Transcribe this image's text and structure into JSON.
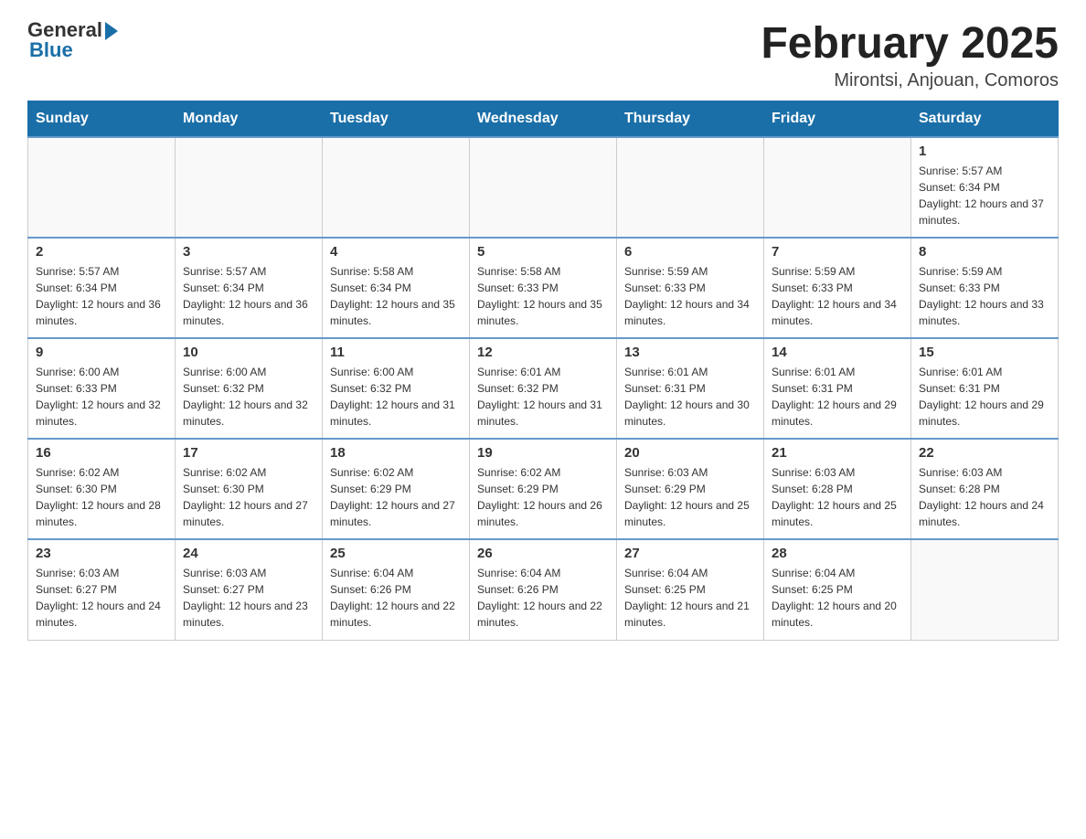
{
  "logo": {
    "general": "General",
    "blue": "Blue"
  },
  "title": "February 2025",
  "subtitle": "Mirontsi, Anjouan, Comoros",
  "days_of_week": [
    "Sunday",
    "Monday",
    "Tuesday",
    "Wednesday",
    "Thursday",
    "Friday",
    "Saturday"
  ],
  "weeks": [
    [
      {
        "day": "",
        "info": ""
      },
      {
        "day": "",
        "info": ""
      },
      {
        "day": "",
        "info": ""
      },
      {
        "day": "",
        "info": ""
      },
      {
        "day": "",
        "info": ""
      },
      {
        "day": "",
        "info": ""
      },
      {
        "day": "1",
        "info": "Sunrise: 5:57 AM\nSunset: 6:34 PM\nDaylight: 12 hours and 37 minutes."
      }
    ],
    [
      {
        "day": "2",
        "info": "Sunrise: 5:57 AM\nSunset: 6:34 PM\nDaylight: 12 hours and 36 minutes."
      },
      {
        "day": "3",
        "info": "Sunrise: 5:57 AM\nSunset: 6:34 PM\nDaylight: 12 hours and 36 minutes."
      },
      {
        "day": "4",
        "info": "Sunrise: 5:58 AM\nSunset: 6:34 PM\nDaylight: 12 hours and 35 minutes."
      },
      {
        "day": "5",
        "info": "Sunrise: 5:58 AM\nSunset: 6:33 PM\nDaylight: 12 hours and 35 minutes."
      },
      {
        "day": "6",
        "info": "Sunrise: 5:59 AM\nSunset: 6:33 PM\nDaylight: 12 hours and 34 minutes."
      },
      {
        "day": "7",
        "info": "Sunrise: 5:59 AM\nSunset: 6:33 PM\nDaylight: 12 hours and 34 minutes."
      },
      {
        "day": "8",
        "info": "Sunrise: 5:59 AM\nSunset: 6:33 PM\nDaylight: 12 hours and 33 minutes."
      }
    ],
    [
      {
        "day": "9",
        "info": "Sunrise: 6:00 AM\nSunset: 6:33 PM\nDaylight: 12 hours and 32 minutes."
      },
      {
        "day": "10",
        "info": "Sunrise: 6:00 AM\nSunset: 6:32 PM\nDaylight: 12 hours and 32 minutes."
      },
      {
        "day": "11",
        "info": "Sunrise: 6:00 AM\nSunset: 6:32 PM\nDaylight: 12 hours and 31 minutes."
      },
      {
        "day": "12",
        "info": "Sunrise: 6:01 AM\nSunset: 6:32 PM\nDaylight: 12 hours and 31 minutes."
      },
      {
        "day": "13",
        "info": "Sunrise: 6:01 AM\nSunset: 6:31 PM\nDaylight: 12 hours and 30 minutes."
      },
      {
        "day": "14",
        "info": "Sunrise: 6:01 AM\nSunset: 6:31 PM\nDaylight: 12 hours and 29 minutes."
      },
      {
        "day": "15",
        "info": "Sunrise: 6:01 AM\nSunset: 6:31 PM\nDaylight: 12 hours and 29 minutes."
      }
    ],
    [
      {
        "day": "16",
        "info": "Sunrise: 6:02 AM\nSunset: 6:30 PM\nDaylight: 12 hours and 28 minutes."
      },
      {
        "day": "17",
        "info": "Sunrise: 6:02 AM\nSunset: 6:30 PM\nDaylight: 12 hours and 27 minutes."
      },
      {
        "day": "18",
        "info": "Sunrise: 6:02 AM\nSunset: 6:29 PM\nDaylight: 12 hours and 27 minutes."
      },
      {
        "day": "19",
        "info": "Sunrise: 6:02 AM\nSunset: 6:29 PM\nDaylight: 12 hours and 26 minutes."
      },
      {
        "day": "20",
        "info": "Sunrise: 6:03 AM\nSunset: 6:29 PM\nDaylight: 12 hours and 25 minutes."
      },
      {
        "day": "21",
        "info": "Sunrise: 6:03 AM\nSunset: 6:28 PM\nDaylight: 12 hours and 25 minutes."
      },
      {
        "day": "22",
        "info": "Sunrise: 6:03 AM\nSunset: 6:28 PM\nDaylight: 12 hours and 24 minutes."
      }
    ],
    [
      {
        "day": "23",
        "info": "Sunrise: 6:03 AM\nSunset: 6:27 PM\nDaylight: 12 hours and 24 minutes."
      },
      {
        "day": "24",
        "info": "Sunrise: 6:03 AM\nSunset: 6:27 PM\nDaylight: 12 hours and 23 minutes."
      },
      {
        "day": "25",
        "info": "Sunrise: 6:04 AM\nSunset: 6:26 PM\nDaylight: 12 hours and 22 minutes."
      },
      {
        "day": "26",
        "info": "Sunrise: 6:04 AM\nSunset: 6:26 PM\nDaylight: 12 hours and 22 minutes."
      },
      {
        "day": "27",
        "info": "Sunrise: 6:04 AM\nSunset: 6:25 PM\nDaylight: 12 hours and 21 minutes."
      },
      {
        "day": "28",
        "info": "Sunrise: 6:04 AM\nSunset: 6:25 PM\nDaylight: 12 hours and 20 minutes."
      },
      {
        "day": "",
        "info": ""
      }
    ]
  ]
}
